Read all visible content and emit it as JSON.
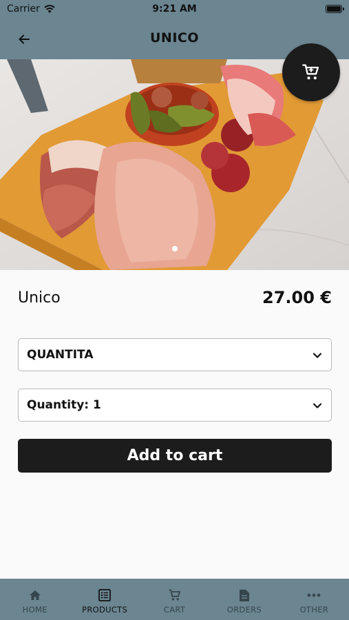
{
  "status_bar": {
    "carrier": "Carrier",
    "time": "9:21 AM"
  },
  "header": {
    "title": "UNICO"
  },
  "product": {
    "name": "Unico",
    "price": "27.00 €"
  },
  "options": {
    "variant_label": "QUANTITA",
    "quantity_label": "Quantity: 1"
  },
  "actions": {
    "add_to_cart": "Add to cart"
  },
  "tabs": [
    {
      "label": "HOME",
      "icon": "home-icon",
      "active": false
    },
    {
      "label": "PRODUCTS",
      "icon": "list-icon",
      "active": true
    },
    {
      "label": "CART",
      "icon": "cart-icon",
      "active": false
    },
    {
      "label": "ORDERS",
      "icon": "document-icon",
      "active": false
    },
    {
      "label": "OTHER",
      "icon": "more-icon",
      "active": false
    }
  ],
  "colors": {
    "bar": "#6b8591",
    "button": "#1c1c1c",
    "background": "#fafafa"
  }
}
